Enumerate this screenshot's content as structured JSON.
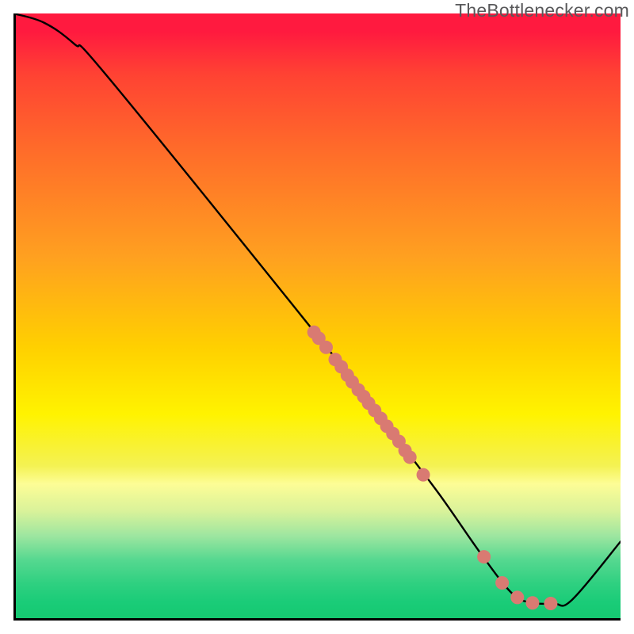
{
  "watermark": "TheBottlenecker.com",
  "chart_data": {
    "type": "line",
    "title": "",
    "xlabel": "",
    "ylabel": "",
    "xlim": [
      0,
      100
    ],
    "ylim": [
      0,
      100
    ],
    "curve": [
      {
        "x": 0,
        "y": 100
      },
      {
        "x": 5,
        "y": 98.5
      },
      {
        "x": 10,
        "y": 95
      },
      {
        "x": 16,
        "y": 89
      },
      {
        "x": 52,
        "y": 44.5
      },
      {
        "x": 62,
        "y": 31.5
      },
      {
        "x": 70,
        "y": 21
      },
      {
        "x": 77,
        "y": 11
      },
      {
        "x": 82,
        "y": 4.6
      },
      {
        "x": 85,
        "y": 3.0
      },
      {
        "x": 89,
        "y": 2.8
      },
      {
        "x": 92,
        "y": 3.4
      },
      {
        "x": 100,
        "y": 13
      }
    ],
    "scatter": [
      {
        "x": 49.5,
        "y": 47.5
      },
      {
        "x": 50.3,
        "y": 46.5
      },
      {
        "x": 51.5,
        "y": 45.0
      },
      {
        "x": 53.0,
        "y": 43.0
      },
      {
        "x": 54.0,
        "y": 41.8
      },
      {
        "x": 55.0,
        "y": 40.4
      },
      {
        "x": 55.8,
        "y": 39.3
      },
      {
        "x": 56.8,
        "y": 38.0
      },
      {
        "x": 57.7,
        "y": 36.9
      },
      {
        "x": 58.5,
        "y": 35.8
      },
      {
        "x": 59.5,
        "y": 34.6
      },
      {
        "x": 60.5,
        "y": 33.3
      },
      {
        "x": 61.5,
        "y": 32.0
      },
      {
        "x": 62.5,
        "y": 30.8
      },
      {
        "x": 63.5,
        "y": 29.5
      },
      {
        "x": 64.5,
        "y": 28.0
      },
      {
        "x": 65.3,
        "y": 26.9
      },
      {
        "x": 67.5,
        "y": 24.0
      },
      {
        "x": 77.5,
        "y": 10.5
      },
      {
        "x": 80.5,
        "y": 6.2
      },
      {
        "x": 83.0,
        "y": 3.8
      },
      {
        "x": 85.5,
        "y": 2.9
      },
      {
        "x": 88.5,
        "y": 2.8
      }
    ],
    "scatter_color": "#d97a72",
    "curve_color": "#000000",
    "gradient_stops": [
      {
        "pos": 0,
        "color": "#ff1a3f"
      },
      {
        "pos": 40,
        "color": "#ffa020"
      },
      {
        "pos": 66,
        "color": "#fff300"
      },
      {
        "pos": 100,
        "color": "#14c870"
      }
    ]
  }
}
